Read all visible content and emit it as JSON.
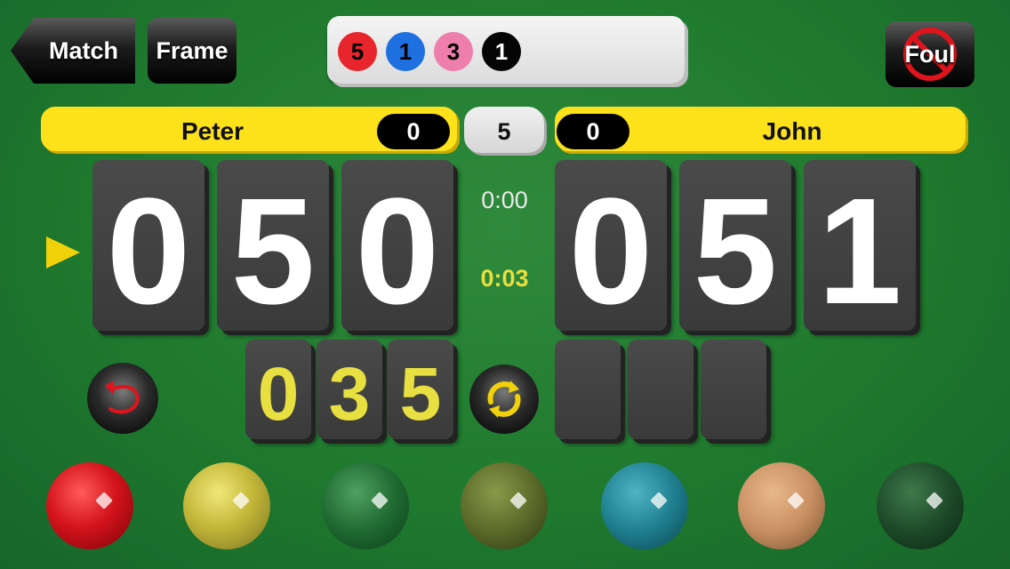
{
  "nav": {
    "back_label": "Match",
    "frame_label": "Frame",
    "foul_label": "Foul"
  },
  "break_balls": [
    {
      "value": "5",
      "color": "#e8242c"
    },
    {
      "value": "1",
      "color": "#1e6fe0"
    },
    {
      "value": "3",
      "color": "#ee7fad"
    },
    {
      "value": "1",
      "color": "#050505"
    }
  ],
  "players": {
    "left": {
      "name": "Peter",
      "frames": "0",
      "score_digits": [
        "0",
        "5",
        "0"
      ]
    },
    "right": {
      "name": "John",
      "frames": "0",
      "score_digits": [
        "0",
        "5",
        "1"
      ]
    }
  },
  "total_frames": "5",
  "timers": {
    "frame_time": "0:00",
    "shot_time": "0:03"
  },
  "current_break_digits": [
    "0",
    "3",
    "5"
  ],
  "icons": {
    "undo": "undo-arrow-icon",
    "switch": "switch-player-icon",
    "foul": "no-foul-icon",
    "turn": "turn-indicator-icon"
  },
  "colors": {
    "name_bar": "#fde11b",
    "timer_active": "#e8df40",
    "table": "#1f7a2e"
  },
  "balls": [
    {
      "name": "red",
      "color": "#d4141c"
    },
    {
      "name": "yellow",
      "color": "#d9c93c"
    },
    {
      "name": "green",
      "color": "#1f6a32"
    },
    {
      "name": "brown",
      "color": "#5c6a2a"
    },
    {
      "name": "blue",
      "color": "#1f7f8f"
    },
    {
      "name": "pink",
      "color": "#c99062"
    },
    {
      "name": "black",
      "color": "#1e4a2a"
    }
  ]
}
